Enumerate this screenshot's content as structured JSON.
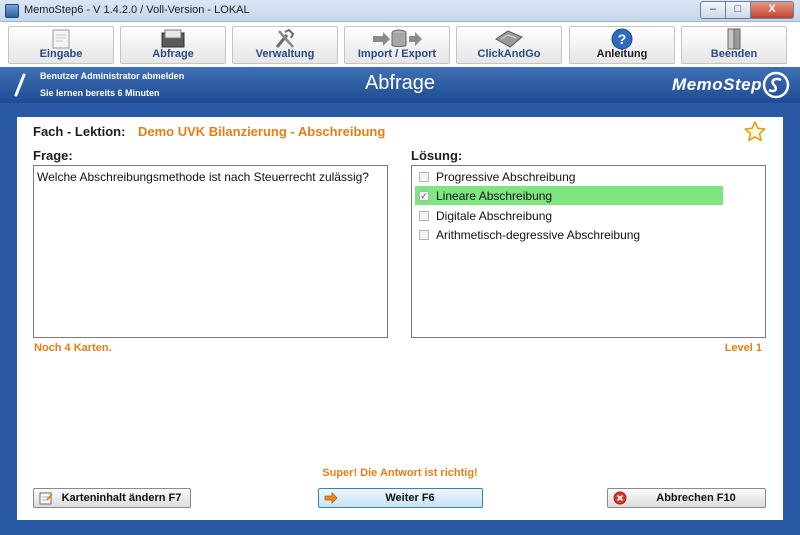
{
  "window": {
    "title": "MemoStep6 - V 1.4.2.0  /  Voll-Version  -  LOKAL",
    "min_label": "–",
    "max_label": "□",
    "close_label": "X"
  },
  "toolbar": {
    "items": [
      {
        "label": "Eingabe",
        "icon": "notepad-icon"
      },
      {
        "label": "Abfrage",
        "icon": "card-box-icon"
      },
      {
        "label": "Verwaltung",
        "icon": "tools-icon"
      },
      {
        "label": "Import / Export",
        "icon": "database-transfer-icon"
      },
      {
        "label": "ClickAndGo",
        "icon": "click-and-go-icon"
      },
      {
        "label": "Anleitung",
        "icon": "help-icon"
      },
      {
        "label": "Beenden",
        "icon": "exit-door-icon"
      }
    ]
  },
  "header": {
    "logout_text": "Benutzer Administrator abmelden",
    "study_time_text": "Sie lernen bereits 6 Minuten",
    "page_title": "Abfrage",
    "logo_text": "MemoStep"
  },
  "lesson": {
    "label": "Fach - Lektion:",
    "value": "Demo UVK Bilanzierung - Abschreibung"
  },
  "question": {
    "label": "Frage:",
    "text": "Welche Abschreibungsmethode ist nach Steuerrecht zulässig?"
  },
  "solution": {
    "label": "Lösung:",
    "options": [
      {
        "text": "Progressive Abschreibung",
        "checked": false,
        "correct": false
      },
      {
        "text": "Lineare Abschreibung",
        "checked": true,
        "correct": true
      },
      {
        "text": "Digitale Abschreibung",
        "checked": false,
        "correct": false
      },
      {
        "text": "Arithmetisch-degressive Abschreibung",
        "checked": false,
        "correct": false
      }
    ]
  },
  "status": {
    "cards_left": "Noch 4 Karten.",
    "level": "Level 1",
    "feedback": "Super! Die Antwort ist richtig!"
  },
  "actions": {
    "edit_label": "Karteninhalt ändern  F7",
    "next_label": "Weiter  F6",
    "cancel_label": "Abbrechen  F10"
  },
  "colors": {
    "accent_orange": "#e67e14",
    "frame_blue": "#2a5aa5",
    "correct_green": "#7ee680"
  }
}
